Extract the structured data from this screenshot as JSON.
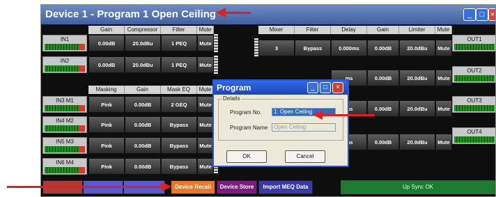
{
  "window": {
    "title": "Device 1  -  Program 1  Open Ceiling"
  },
  "inputs": {
    "headers": [
      "Gain",
      "Compressor",
      "Filter",
      "Mute"
    ],
    "rows": [
      {
        "label": "IN1",
        "gain": "0.00dB",
        "comp": "20.0dBu",
        "filter": "1 PEQ",
        "mute": "Mute"
      },
      {
        "label": "IN2",
        "gain": "0.00dB",
        "comp": "20.0dBu",
        "filter": "1 PEQ",
        "mute": "Mute"
      }
    ]
  },
  "masking": {
    "headers": [
      "Masking",
      "Gain",
      "Mask EQ",
      "Mute"
    ],
    "rows": [
      {
        "label": "IN3 M1",
        "mask": "Pink",
        "gain": "0.00dB",
        "eq": "2 GEQ",
        "mute": "Mute"
      },
      {
        "label": "IN4 M2",
        "mask": "Pink",
        "gain": "0.00dB",
        "eq": "Bypass",
        "mute": "Mute"
      },
      {
        "label": "IN5 M3",
        "mask": "Pink",
        "gain": "0.00dB",
        "eq": "Bypass",
        "mute": "Mute"
      },
      {
        "label": "IN6 M4",
        "mask": "Pink",
        "gain": "0.00dB",
        "eq": "Bypass",
        "mute": "Mute"
      }
    ]
  },
  "outputs": {
    "headers": [
      "Mixer",
      "Filter",
      "Delay",
      "Gain",
      "Limiter",
      "Mute"
    ],
    "row1": {
      "mixer": "3",
      "filter": "Bypass",
      "delay": "0.000ms",
      "gain": "0.00dB",
      "limiter": "20.0dBu",
      "mute": "Mute"
    },
    "partial_rows": [
      {
        "delay": "ms",
        "gain": "0.00dB",
        "limiter": "20.0dBu",
        "mute": "Mute"
      },
      {
        "delay": "ms",
        "gain": "0.00dB",
        "limiter": "20.0dBu",
        "mute": "Mute"
      },
      {
        "delay": "ms",
        "gain": "0.00dB",
        "limiter": "20.0dBu",
        "mute": "Mute"
      }
    ],
    "labels": [
      "OUT1",
      "OUT2",
      "OUT3",
      "OUT4"
    ]
  },
  "toolbar": {
    "device_recall": "Device Recall",
    "device_store": "Device Store",
    "import_meq": "Import MEQ Data",
    "sync_status": "Up Sync OK"
  },
  "dialog": {
    "title": "Program",
    "group": "Details",
    "program_no_label": "Program No.",
    "program_no_value": "1: Open Ceiling",
    "program_name_label": "Program Name",
    "program_name_value": "Open Ceiling",
    "ok": "OK",
    "cancel": "Cancel"
  },
  "colors": {
    "device_recall_bg": "#e8782a",
    "device_store_bg": "#7a1e7a",
    "import_meq_bg": "#3a3aa8",
    "sync_bg": "#1e7a2e",
    "arrow": "#e0201f"
  }
}
